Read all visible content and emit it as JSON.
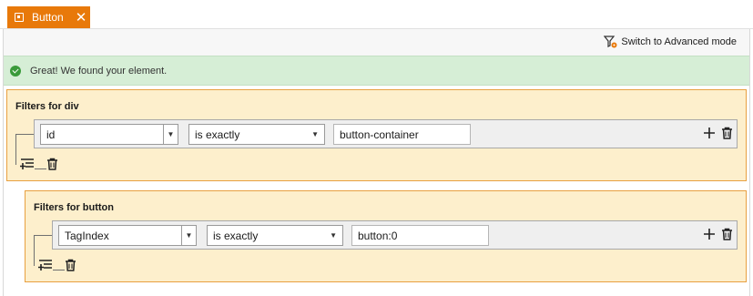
{
  "tab": {
    "label": "Button",
    "close_glyph": "✕"
  },
  "toolbar": {
    "advanced_label": "Switch to Advanced mode"
  },
  "status": {
    "message": "Great! We found your element."
  },
  "groups": [
    {
      "title": "Filters for div",
      "rules": [
        {
          "field": "id",
          "operator": "is exactly",
          "value": "button-container"
        }
      ]
    },
    {
      "title": "Filters for button",
      "rules": [
        {
          "field": "TagIndex",
          "operator": "is exactly",
          "value": "button:0"
        }
      ]
    }
  ],
  "icons": {
    "tab": "selector-tab-icon",
    "advanced": "filter-settings-icon",
    "success": "check-circle-icon",
    "add": "plus-icon",
    "delete": "trash-icon",
    "add_rule": "add-rule-icon"
  },
  "colors": {
    "accent_orange": "#e8790a",
    "group_bg": "#fdefcc",
    "group_border": "#e8a040",
    "success_bg": "#d6eed6",
    "success_icon": "#3a9a3a"
  }
}
